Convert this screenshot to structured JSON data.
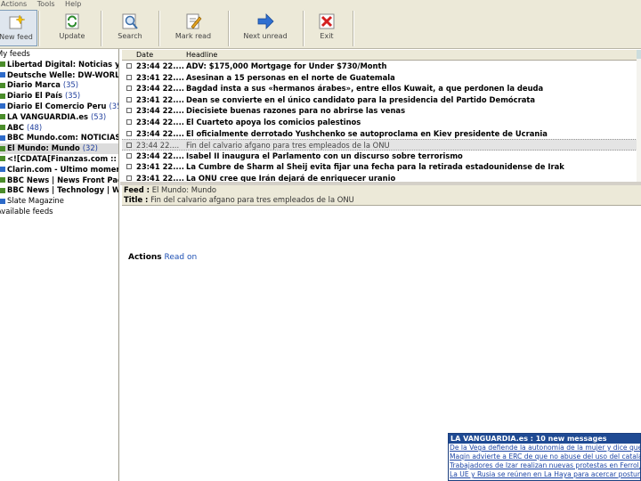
{
  "menu": [
    "Actions",
    "Tools",
    "Help"
  ],
  "toolbar": {
    "buttons": [
      {
        "label": "New feed",
        "icon": "new-feed-icon"
      },
      {
        "label": "Update",
        "icon": "update-icon"
      },
      {
        "label": "Search",
        "icon": "search-icon"
      },
      {
        "label": "Mark read",
        "icon": "mark-read-icon"
      },
      {
        "label": "Next unread",
        "icon": "next-arrow-icon"
      },
      {
        "label": "Exit",
        "icon": "exit-icon"
      }
    ]
  },
  "feeds": {
    "root": "My feeds",
    "items": [
      {
        "name": "Libertad Digital: Noticias y opi",
        "count": ""
      },
      {
        "name": "Deutsche Welle: DW-WORLD.D",
        "count": ""
      },
      {
        "name": "Diario Marca",
        "count": "(35)"
      },
      {
        "name": "Diario El País",
        "count": "(35)"
      },
      {
        "name": "Diario El Comercio Peru",
        "count": "(35)"
      },
      {
        "name": "LA VANGUARDIA.es",
        "count": "(53)"
      },
      {
        "name": "ABC",
        "count": "(48)"
      },
      {
        "name": "BBC Mundo.com: NOTICIAS",
        "count": "(26"
      },
      {
        "name": "El Mundo: Mundo",
        "count": "(32)"
      },
      {
        "name": "<![CDATA[Finanzas.com :: Top",
        "count": ""
      },
      {
        "name": "Clarin.com - Ultimo momento",
        "count": ""
      },
      {
        "name": "BBC News | News Front Page",
        "count": ""
      },
      {
        "name": "BBC News | Technology | Wor",
        "count": ""
      },
      {
        "name": "Slate Magazine",
        "count": ""
      }
    ],
    "available": "Available feeds"
  },
  "list": {
    "columns": [
      "Date",
      "Headline"
    ],
    "rows": [
      {
        "date": "23:44 22....",
        "headline": "ADV: $175,000 Mortgage for Under $730/Month",
        "read": false
      },
      {
        "date": "23:41 22....",
        "headline": "Asesinan a 15 personas en el norte de Guatemala",
        "read": false
      },
      {
        "date": "23:44 22....",
        "headline": "Bagdad insta a sus «hermanos árabes», entre ellos Kuwait, a que perdonen la deuda",
        "read": false
      },
      {
        "date": "23:41 22....",
        "headline": "Dean se convierte en el único candidato para la presidencia del Partido Demócrata",
        "read": false
      },
      {
        "date": "23:44 22....",
        "headline": "Diecisiete buenas razones para no abrirse las venas",
        "read": false
      },
      {
        "date": "23:44 22....",
        "headline": "El Cuarteto apoya los comicios palestinos",
        "read": false
      },
      {
        "date": "23:44 22....",
        "headline": "El oficialmente derrotado Yushchenko se autoproclama en Kiev presidente de Ucrania",
        "read": false
      },
      {
        "date": "23:44 22....",
        "headline": "Fin del calvario afgano para tres empleados de la ONU",
        "read": true
      },
      {
        "date": "23:44 22....",
        "headline": "Isabel II inaugura el Parlamento con un discurso sobre terrorismo",
        "read": false
      },
      {
        "date": "23:41 22....",
        "headline": "La Cumbre de Sharm al Sheij evita fijar una fecha para la retirada estadounidense de Irak",
        "read": false
      },
      {
        "date": "23:41 22....",
        "headline": "La ONU cree que Irán dejará de enriquecer uranio",
        "read": false
      }
    ]
  },
  "detail": {
    "feed_label": "Feed :",
    "feed_value": "El Mundo: Mundo",
    "title_label": "Title :",
    "title_value": "Fin del calvario afgano para tres empleados de la ONU",
    "actions_label": "Actions",
    "actions_link": "Read on"
  },
  "popup": {
    "title": "LA VANGUARDIA.es : 10 new messages",
    "items": [
      "De la Vega defiende la autonomía de la mujer y dice que se",
      "Maqin advierte a ERC de que no abuse del uso del catalán",
      "Trabajadores de Izar realizan nuevas protestas en Ferrol,",
      "La UE y Rusia se reúnen en La Haya para acercar postura"
    ]
  },
  "colors": {
    "toolbar_bg": "#ece9d8",
    "link": "#1e50b4",
    "popup_header": "#1f4a93"
  }
}
